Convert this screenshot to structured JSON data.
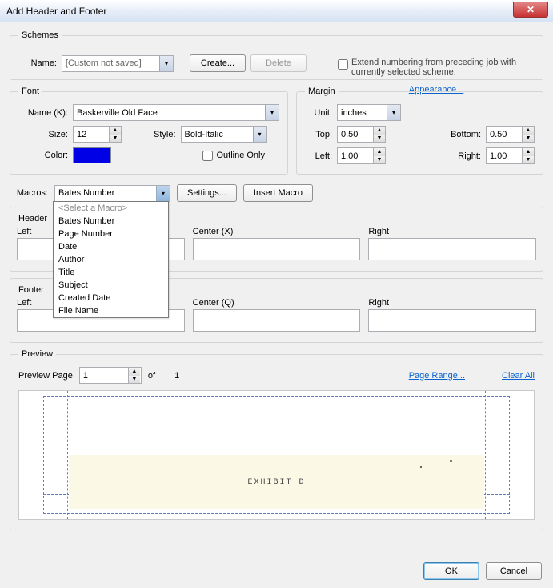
{
  "window": {
    "title": "Add Header and Footer"
  },
  "schemes": {
    "legend": "Schemes",
    "name_label": "Name:",
    "name_value": "[Custom not saved]",
    "create_label": "Create...",
    "delete_label": "Delete",
    "extend_label": "Extend numbering from preceding job with currently selected scheme.",
    "appearance_link": "Appearance..."
  },
  "font": {
    "legend": "Font",
    "name_label": "Name (K):",
    "name_value": "Baskerville Old Face",
    "size_label": "Size:",
    "size_value": "12",
    "style_label": "Style:",
    "style_value": "Bold-Italic",
    "color_label": "Color:",
    "color_value": "#0000E6",
    "outline_label": "Outline Only"
  },
  "margin": {
    "legend": "Margin",
    "unit_label": "Unit:",
    "unit_value": "inches",
    "top_label": "Top:",
    "top_value": "0.50",
    "bottom_label": "Bottom:",
    "bottom_value": "0.50",
    "left_label": "Left:",
    "left_value": "1.00",
    "right_label": "Right:",
    "right_value": "1.00"
  },
  "macros": {
    "label": "Macros:",
    "selected": "Bates Number",
    "settings_label": "Settings...",
    "insert_label": "Insert Macro",
    "options": {
      "placeholder": "<Select a Macro>",
      "o1": "Bates Number",
      "o2": "Page Number",
      "o3": "Date",
      "o4": "Author",
      "o5": "Title",
      "o6": "Subject",
      "o7": "Created Date",
      "o8": "File Name"
    }
  },
  "header": {
    "title": "Header",
    "left_label": "Left",
    "center_label": "Center (X)",
    "right_label": "Right"
  },
  "footer": {
    "title": "Footer",
    "left_label": "Left",
    "center_label": "Center (Q)",
    "right_label": "Right"
  },
  "preview": {
    "legend": "Preview",
    "page_label": "Preview Page",
    "page_value": "1",
    "of_label": "of",
    "total": "1",
    "range_link": "Page Range...",
    "clear_link": "Clear All",
    "content_text": "EXHIBIT D"
  },
  "buttons": {
    "ok": "OK",
    "cancel": "Cancel"
  }
}
